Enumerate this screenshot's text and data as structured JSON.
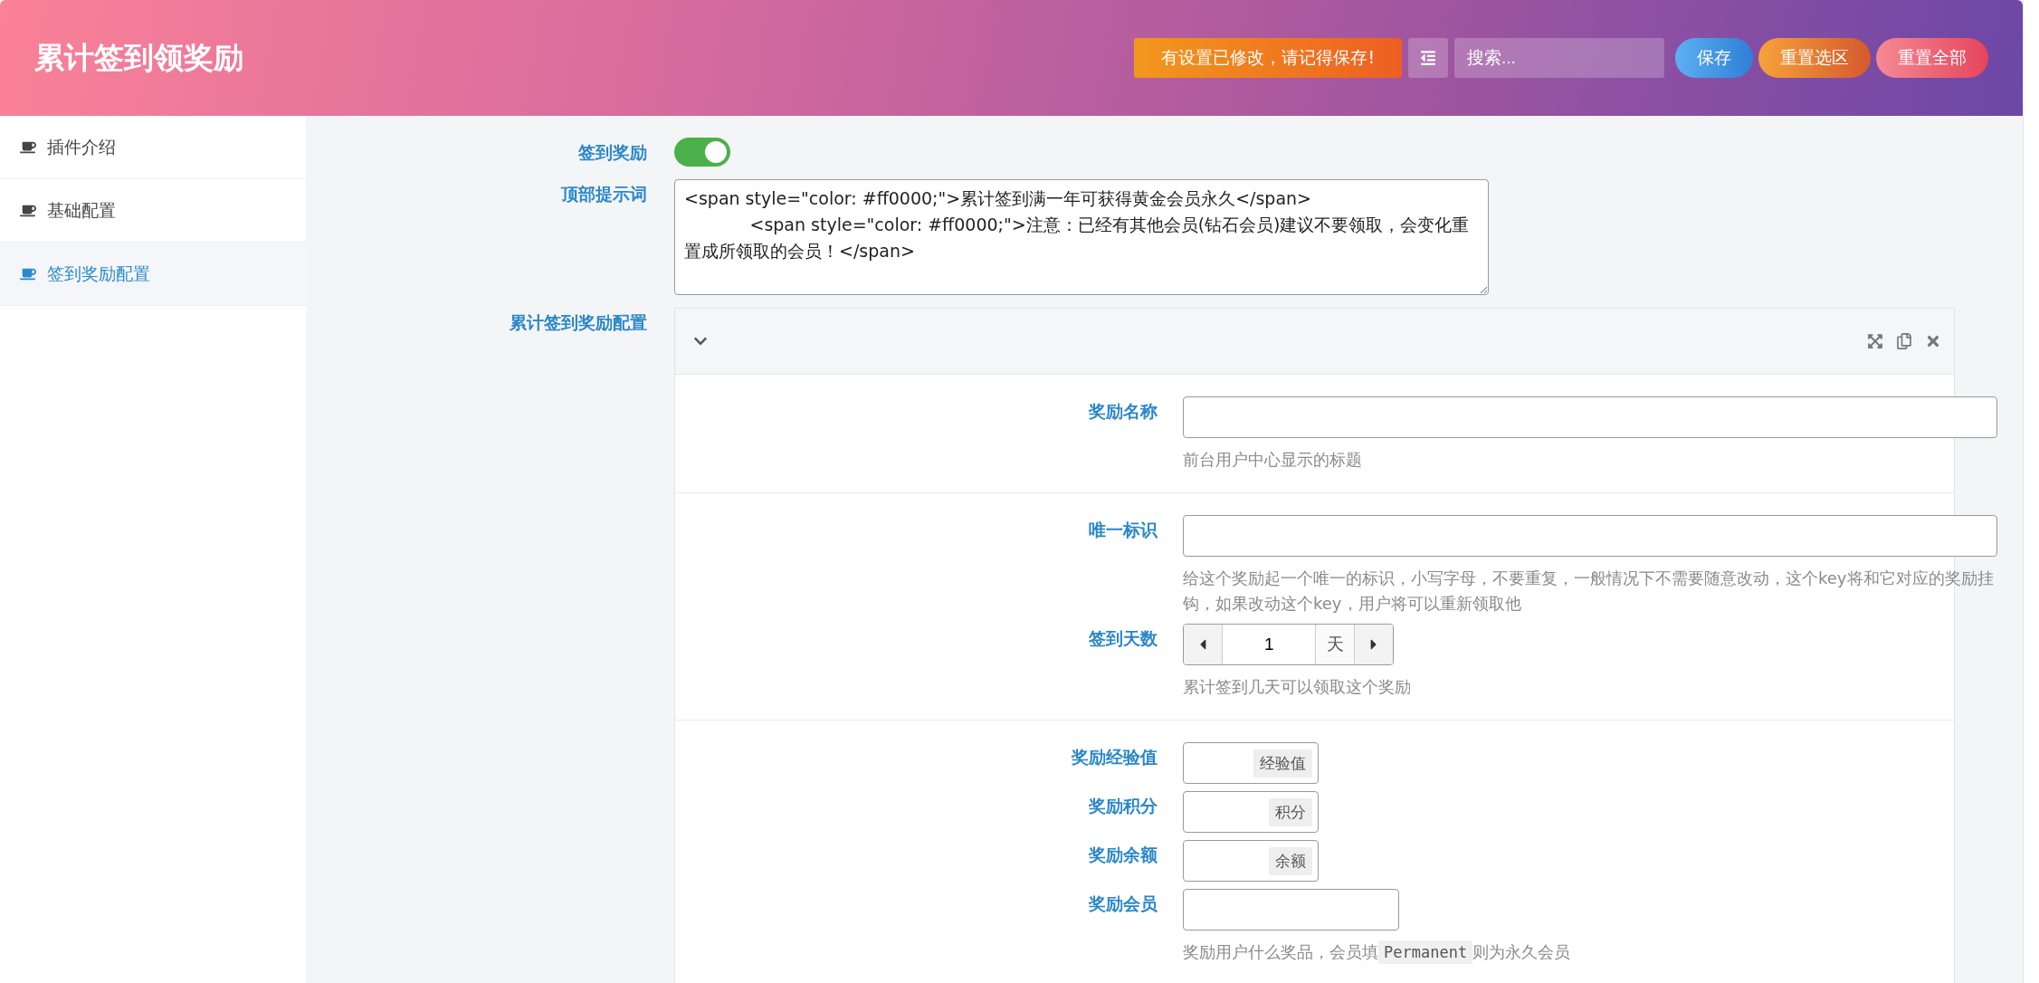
{
  "header": {
    "title": "累计签到领奖励",
    "notice": "有设置已修改，请记得保存!",
    "search": {
      "placeholder": "搜索..."
    },
    "buttons": [
      {
        "label": "保存",
        "kind": "save"
      },
      {
        "label": "重置选区",
        "kind": "reset-section"
      },
      {
        "label": "重置全部",
        "kind": "reset-all"
      }
    ]
  },
  "sidebar": {
    "items": [
      {
        "label": "插件介绍",
        "selected": false
      },
      {
        "label": "基础配置",
        "selected": false
      },
      {
        "label": "签到奖励配置",
        "selected": true
      }
    ]
  },
  "fields": {
    "enable": {
      "label": "签到奖励",
      "on": true
    },
    "top_tip": {
      "label": "顶部提示词",
      "value": "<span style=\"color: #ff0000;\">累计签到满一年可获得黄金会员永久</span>\n            <span style=\"color: #ff0000;\">注意：已经有其他会员(钻石会员)建议不要领取，会变化重置成所领取的会员！</span>"
    }
  },
  "repeater": {
    "label": "累计签到奖励配置",
    "expanded": true,
    "sections": [
      {
        "fields": [
          {
            "kind": "text",
            "label": "奖励名称",
            "help": [
              {
                "kind": "text",
                "text": "前台用户中心显示的标题"
              }
            ]
          }
        ]
      },
      {
        "fields": [
          {
            "kind": "text",
            "label": "唯一标识",
            "help": [
              {
                "kind": "text",
                "text": "给这个奖励起一个唯一的标识，小写字母，不要重复，一般情况下不需要随意改动，这个key将和它对应的奖励挂钩，如果改动这个key，用户将可以重新领取他"
              }
            ]
          },
          {
            "kind": "spinner",
            "label": "签到天数",
            "value": "1",
            "unit": "天",
            "help": [
              {
                "kind": "text",
                "text": "累计签到几天可以领取这个奖励"
              }
            ]
          }
        ]
      },
      {
        "fields": [
          {
            "kind": "addon",
            "label": "奖励经验值",
            "unit": "经验值"
          },
          {
            "kind": "addon",
            "label": "奖励积分",
            "unit": "积分"
          },
          {
            "kind": "addon",
            "label": "奖励余额",
            "unit": "余额"
          },
          {
            "kind": "short",
            "label": "奖励会员",
            "help": [
              {
                "kind": "text",
                "text": "奖励用户什么奖品，会员填"
              },
              {
                "kind": "code",
                "text": "Permanent"
              },
              {
                "kind": "text",
                "text": "则为永久会员"
              }
            ]
          }
        ]
      }
    ]
  }
}
